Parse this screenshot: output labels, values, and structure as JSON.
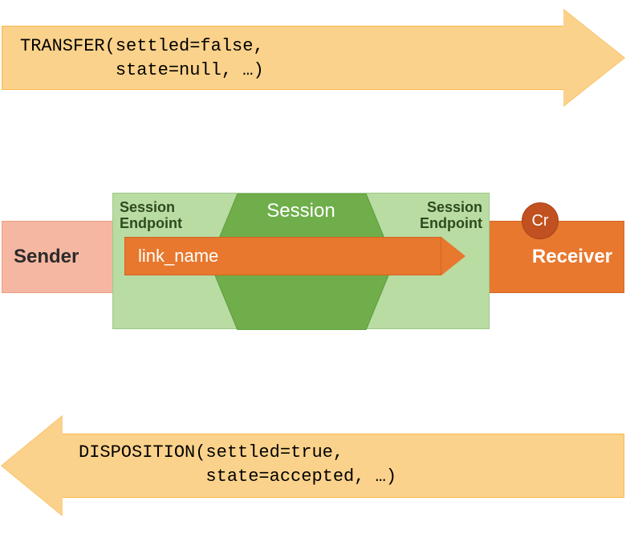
{
  "top_arrow": {
    "line1": "TRANSFER(settled=false,",
    "line2": "         state=null, …)"
  },
  "bottom_arrow": {
    "line1": "DISPOSITION(settled=true,",
    "line2": "            state=accepted, …)"
  },
  "middle": {
    "sender": "Sender",
    "receiver": "Receiver",
    "session_ep_left_l1": "Session",
    "session_ep_left_l2": "Endpoint",
    "session_ep_right_l1": "Session",
    "session_ep_right_l2": "Endpoint",
    "session_title": "Session",
    "link_name": "link_name",
    "credit": "Cr"
  },
  "colors": {
    "arrow_fill": "#fbd28b",
    "sender_fill": "#f6b7a2",
    "receiver_fill": "#e8782e",
    "session_light": "#b9dca3",
    "session_dark": "#6fae4a",
    "credit_fill": "#c15120"
  },
  "chart_data": {
    "type": "diagram",
    "description": "AMQP message transfer sequence between Sender and Receiver through a Session",
    "nodes": [
      {
        "id": "sender",
        "label": "Sender"
      },
      {
        "id": "session_endpoint_left",
        "label": "Session Endpoint"
      },
      {
        "id": "session",
        "label": "Session"
      },
      {
        "id": "session_endpoint_right",
        "label": "Session Endpoint"
      },
      {
        "id": "receiver",
        "label": "Receiver",
        "badge": "Cr"
      }
    ],
    "link": {
      "name": "link_name",
      "direction": "sender->receiver"
    },
    "messages": [
      {
        "direction": "sender->receiver",
        "performative": "TRANSFER",
        "args": {
          "settled": false,
          "state": null
        }
      },
      {
        "direction": "receiver->sender",
        "performative": "DISPOSITION",
        "args": {
          "settled": true,
          "state": "accepted"
        }
      }
    ]
  }
}
